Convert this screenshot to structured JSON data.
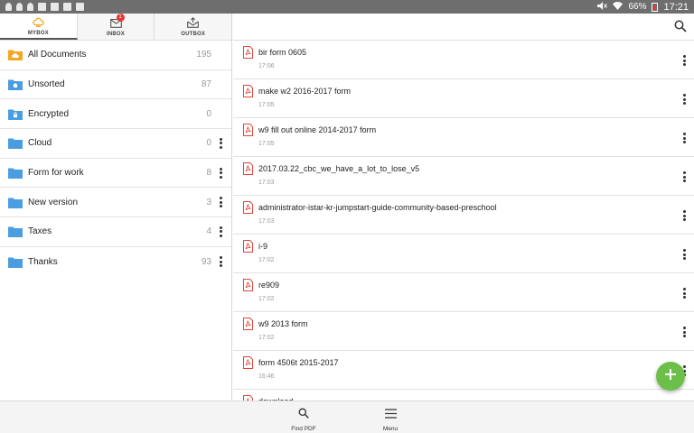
{
  "status_bar": {
    "battery": "66%",
    "time": "17:21"
  },
  "tabs": [
    {
      "label": "MYBOX",
      "icon": "cloud-box-icon",
      "active": true
    },
    {
      "label": "INBOX",
      "icon": "inbox-icon",
      "badge": "1"
    },
    {
      "label": "OUTBOX",
      "icon": "outbox-icon"
    }
  ],
  "folders": [
    {
      "name": "All Documents",
      "count": "195",
      "icon": "cloud-folder-icon",
      "color": "#f5a623",
      "menu": false
    },
    {
      "name": "Unsorted",
      "count": "87",
      "icon": "home-folder-icon",
      "color": "#4a9de0",
      "menu": false
    },
    {
      "name": "Encrypted",
      "count": "0",
      "icon": "lock-folder-icon",
      "color": "#4a9de0",
      "menu": false
    },
    {
      "name": "Cloud",
      "count": "0",
      "icon": "folder-icon",
      "color": "#4a9de0",
      "menu": true
    },
    {
      "name": "Form for work",
      "count": "8",
      "icon": "folder-icon",
      "color": "#4a9de0",
      "menu": true
    },
    {
      "name": "New version",
      "count": "3",
      "icon": "folder-icon",
      "color": "#4a9de0",
      "menu": true
    },
    {
      "name": "Taxes",
      "count": "4",
      "icon": "folder-icon",
      "color": "#4a9de0",
      "menu": true
    },
    {
      "name": "Thanks",
      "count": "93",
      "icon": "folder-icon",
      "color": "#4a9de0",
      "menu": true
    }
  ],
  "files": [
    {
      "name": "bir form 0605",
      "time": "17:06"
    },
    {
      "name": "make w2 2016-2017 form",
      "time": "17:05"
    },
    {
      "name": "w9 fill out online 2014-2017 form",
      "time": "17:05"
    },
    {
      "name": "2017.03.22_cbc_we_have_a_lot_to_lose_v5",
      "time": "17:03"
    },
    {
      "name": "administrator-istar-kr-jumpstart-guide-community-based-preschool",
      "time": "17:03"
    },
    {
      "name": "i-9",
      "time": "17:02"
    },
    {
      "name": "re909",
      "time": "17:02"
    },
    {
      "name": "w9 2013 form",
      "time": "17:02"
    },
    {
      "name": "form 4506t 2015-2017",
      "time": "16:46"
    },
    {
      "name": "download",
      "time": ""
    }
  ],
  "bottom_bar": {
    "find_pdf": "Find PDF",
    "menu": "Menu"
  },
  "colors": {
    "accent_green": "#6cc04a",
    "pdf_red": "#e0453a",
    "folder_blue": "#4a9de0",
    "folder_orange": "#f5a623"
  }
}
